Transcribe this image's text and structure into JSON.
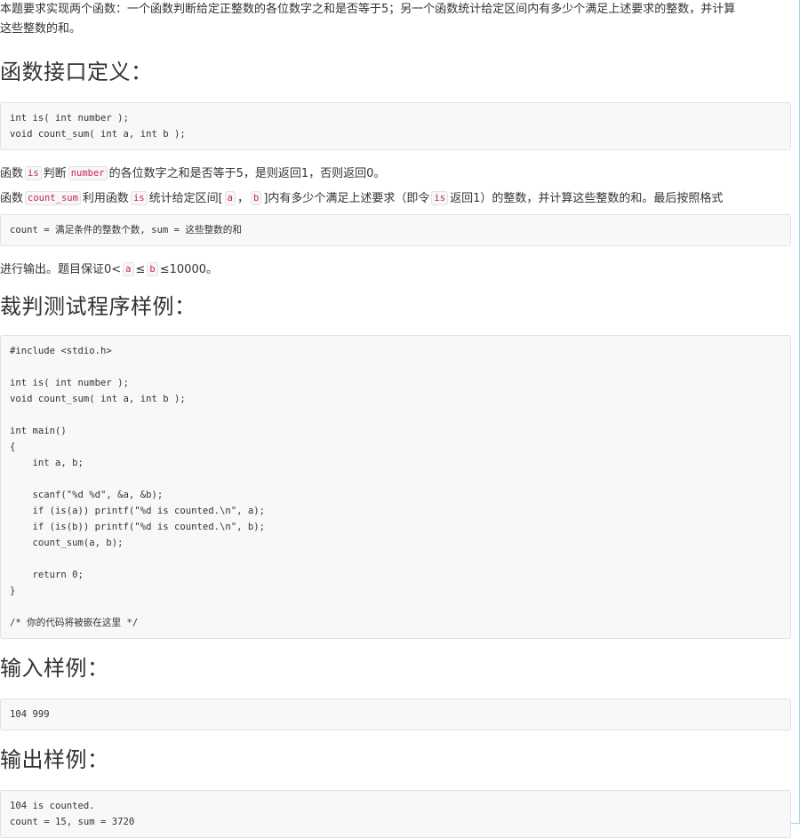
{
  "intro_line1": "本题要求实现两个函数：一个函数判断给定正整数的各位数字之和是否等于5；另一个函数统计给定区间内有多少个满足上述要求的整数，并计算",
  "intro_line2": "这些整数的和。",
  "headings": {
    "interface": "函数接口定义：",
    "judge_program": "裁判测试程序样例：",
    "input_sample": "输入样例：",
    "output_sample": "输出样例："
  },
  "interface_code": "int is( int number );\nvoid count_sum( int a, int b );",
  "desc1": {
    "p1": "函数",
    "c1": "is",
    "p2": "判断",
    "c2": "number",
    "p3": "的各位数字之和是否等于5，是则返回1，否则返回0。"
  },
  "desc2": {
    "p1": "函数",
    "c1": "count_sum",
    "p2": "利用函数",
    "c2": "is",
    "p3": "统计给定区间[",
    "c3": "a",
    "p4": "，",
    "c4": "b",
    "p5": "]内有多少个满足上述要求（即令",
    "c5": "is",
    "p6": "返回1）的整数，并计算这些整数的和。最后按照格式"
  },
  "format_code": "count = 满足条件的整数个数, sum = 这些整数的和",
  "desc3": {
    "p1": "进行输出。题目保证0<",
    "c1": "a",
    "p2": "≤",
    "c2": "b",
    "p3": "≤10000。"
  },
  "judge_code": "#include <stdio.h>\n\nint is( int number );\nvoid count_sum( int a, int b );\n\nint main()\n{\n    int a, b;\n\n    scanf(\"%d %d\", &a, &b);\n    if (is(a)) printf(\"%d is counted.\\n\", a);\n    if (is(b)) printf(\"%d is counted.\\n\", b);\n    count_sum(a, b);\n\n    return 0;\n}\n\n/* 你的代码将被嵌在这里 */",
  "input_code": "104 999",
  "output_code": "104 is counted.\ncount = 15, sum = 3720"
}
